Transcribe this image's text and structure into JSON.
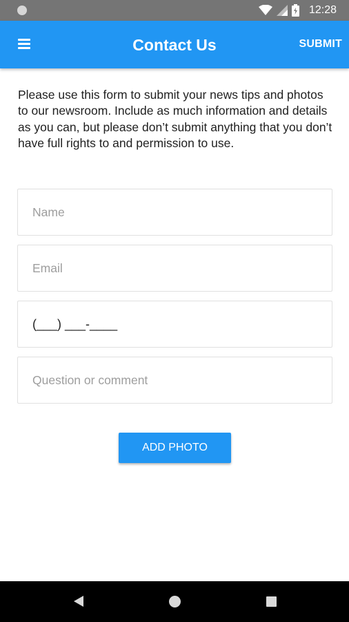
{
  "status_bar": {
    "time": "12:28",
    "icons": [
      "notification-dot-icon",
      "wifi-icon",
      "signal-icon",
      "battery-icon"
    ]
  },
  "app_bar": {
    "title": "Contact Us",
    "action_label": "SUBMIT",
    "menu_icon": "hamburger-menu-icon"
  },
  "intro_text": "Please use this form to submit your news tips and photos to our newsroom. Include as much information and details as you can, but please don’t submit anything that you don’t have full rights to and permission to use.",
  "form": {
    "name_placeholder": "Name",
    "email_placeholder": "Email",
    "phone_mask": "(___) ___-____",
    "comment_placeholder": "Question or comment"
  },
  "add_photo_label": "ADD PHOTO",
  "nav_bar": {
    "icons": [
      "back-icon",
      "home-icon",
      "recent-apps-icon"
    ]
  },
  "colors": {
    "primary": "#2196f3",
    "status_bar": "#757575",
    "nav_bar": "#000000",
    "text": "#212121",
    "placeholder": "#9e9e9e"
  }
}
